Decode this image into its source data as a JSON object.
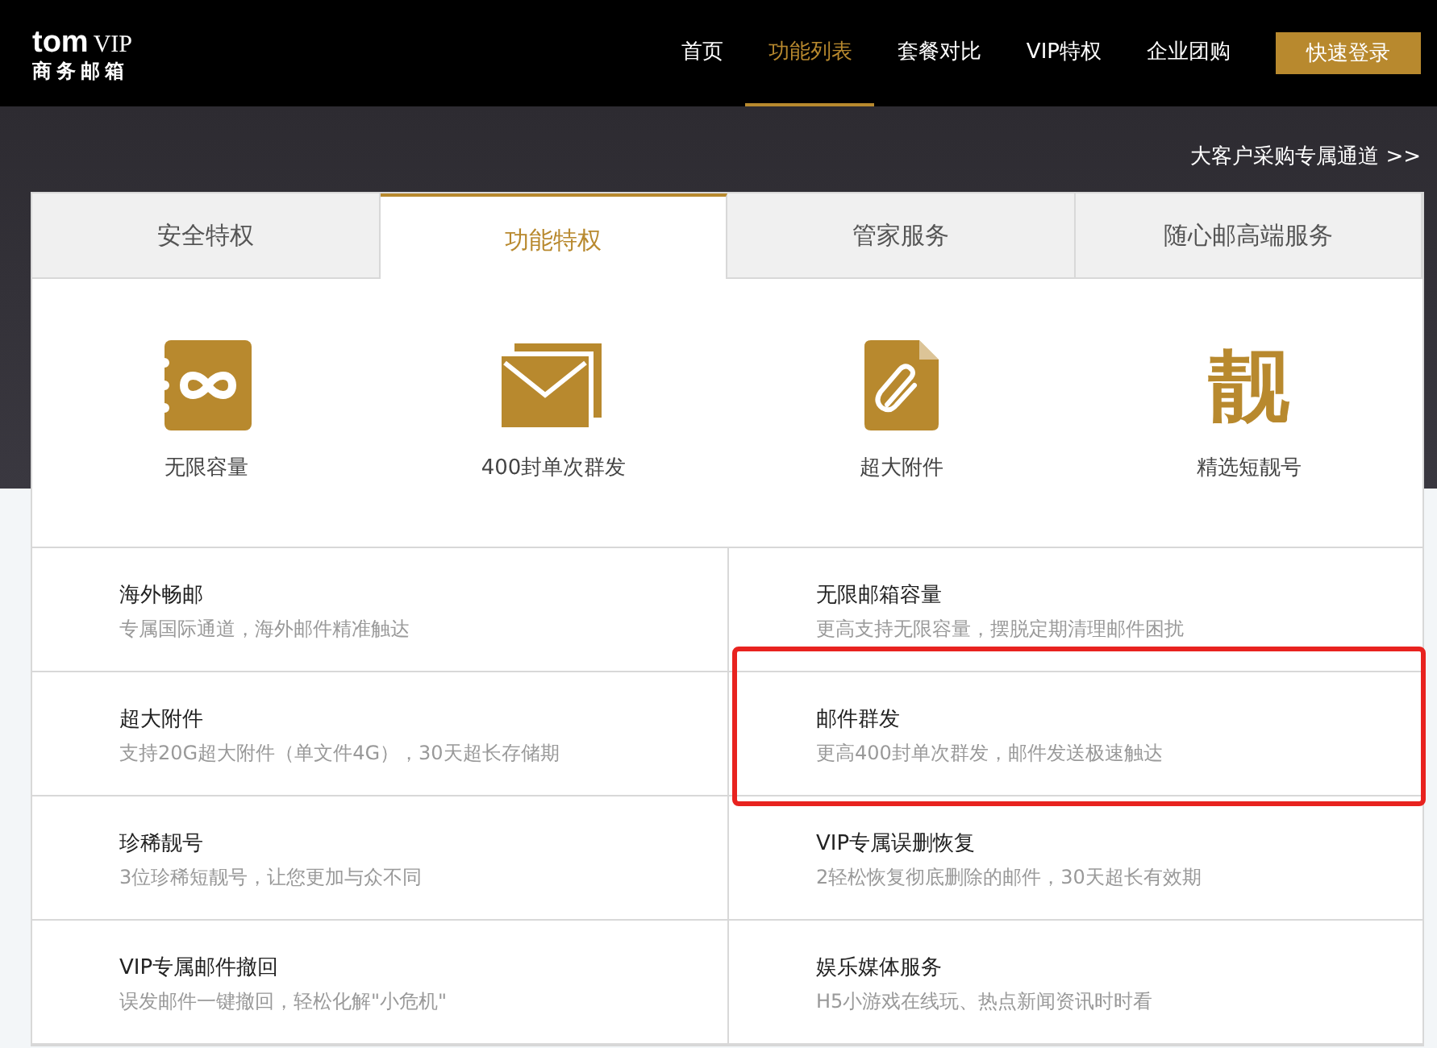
{
  "logo": {
    "brand": "tom",
    "tier": "VIP",
    "subtitle": "商务邮箱"
  },
  "nav": [
    {
      "label": "首页",
      "selected": false
    },
    {
      "label": "功能列表",
      "selected": true
    },
    {
      "label": "套餐对比",
      "selected": false
    },
    {
      "label": "VIP特权",
      "selected": false
    },
    {
      "label": "企业团购",
      "selected": false
    }
  ],
  "login_button": "快速登录",
  "enterprise_link": "大客户采购专属通道 >>",
  "tabs": [
    {
      "label": "安全特权",
      "selected": false
    },
    {
      "label": "功能特权",
      "selected": true
    },
    {
      "label": "管家服务",
      "selected": false
    },
    {
      "label": "随心邮高端服务",
      "selected": false
    }
  ],
  "highlights": [
    {
      "kind": "infinity",
      "label": "无限容量"
    },
    {
      "kind": "envelope",
      "label": "400封单次群发"
    },
    {
      "kind": "clip",
      "label": "超大附件"
    },
    {
      "kind": "glyph",
      "glyph": "靓",
      "label": "精选短靓号"
    }
  ],
  "features": [
    {
      "title": "海外畅邮",
      "desc": "专属国际通道，海外邮件精准触达",
      "highlighted": false
    },
    {
      "title": "无限邮箱容量",
      "desc": "更高支持无限容量，摆脱定期清理邮件困扰",
      "highlighted": false
    },
    {
      "title": "超大附件",
      "desc": "支持20G超大附件（单文件4G），30天超长存储期",
      "highlighted": false
    },
    {
      "title": "邮件群发",
      "desc": "更高400封单次群发，邮件发送极速触达",
      "highlighted": true
    },
    {
      "title": "珍稀靓号",
      "desc": "3位珍稀短靓号，让您更加与众不同",
      "highlighted": false
    },
    {
      "title": "VIP专属误删恢复",
      "desc": "2轻松恢复彻底删除的邮件，30天超长有效期",
      "highlighted": false
    },
    {
      "title": "VIP专属邮件撤回",
      "desc": "误发邮件一键撤回，轻松化解\"小危机\"",
      "highlighted": false
    },
    {
      "title": "娱乐媒体服务",
      "desc": "H5小游戏在线玩、热点新闻资讯时时看",
      "highlighted": false
    }
  ]
}
